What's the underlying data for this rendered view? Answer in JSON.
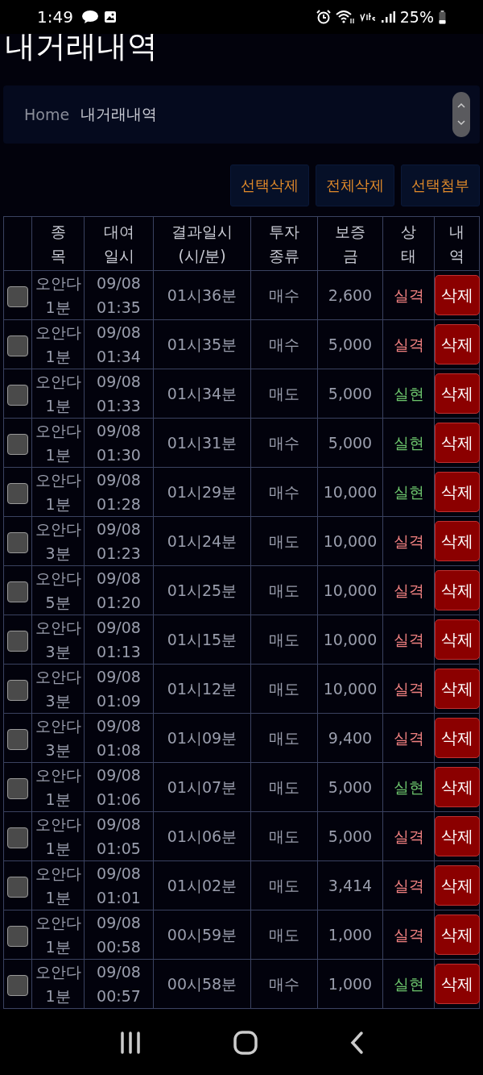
{
  "status_bar": {
    "time": "1:49",
    "battery": "25%"
  },
  "page_title": "내거래내역",
  "breadcrumb": {
    "home": "Home",
    "current": "내거래내역"
  },
  "actions": [
    "선택삭제",
    "전체삭제",
    "선택첨부"
  ],
  "table": {
    "columns": [
      [
        "종",
        "목"
      ],
      [
        "대여",
        "일시"
      ],
      [
        "결과일시",
        "(시/분)"
      ],
      [
        "투자",
        "종류"
      ],
      [
        "보증",
        "금"
      ],
      [
        "상",
        "태"
      ],
      [
        "내",
        "역"
      ]
    ],
    "rows": [
      {
        "checked": false,
        "item": [
          "오안다",
          "1분"
        ],
        "date": [
          "09/08",
          "01:35"
        ],
        "result_time": "01시36분",
        "type": "매수",
        "deposit": "2,600",
        "status": "실격",
        "kind": "fail",
        "action": "삭제"
      },
      {
        "checked": false,
        "item": [
          "오안다",
          "1분"
        ],
        "date": [
          "09/08",
          "01:34"
        ],
        "result_time": "01시35분",
        "type": "매수",
        "deposit": "5,000",
        "status": "실격",
        "kind": "fail",
        "action": "삭제"
      },
      {
        "checked": false,
        "item": [
          "오안다",
          "1분"
        ],
        "date": [
          "09/08",
          "01:33"
        ],
        "result_time": "01시34분",
        "type": "매도",
        "deposit": "5,000",
        "status": "실현",
        "kind": "win",
        "action": "삭제"
      },
      {
        "checked": false,
        "item": [
          "오안다",
          "1분"
        ],
        "date": [
          "09/08",
          "01:30"
        ],
        "result_time": "01시31분",
        "type": "매수",
        "deposit": "5,000",
        "status": "실현",
        "kind": "win",
        "action": "삭제"
      },
      {
        "checked": false,
        "item": [
          "오안다",
          "1분"
        ],
        "date": [
          "09/08",
          "01:28"
        ],
        "result_time": "01시29분",
        "type": "매수",
        "deposit": "10,000",
        "status": "실현",
        "kind": "win",
        "action": "삭제"
      },
      {
        "checked": false,
        "item": [
          "오안다",
          "3분"
        ],
        "date": [
          "09/08",
          "01:23"
        ],
        "result_time": "01시24분",
        "type": "매도",
        "deposit": "10,000",
        "status": "실격",
        "kind": "fail",
        "action": "삭제"
      },
      {
        "checked": false,
        "item": [
          "오안다",
          "5분"
        ],
        "date": [
          "09/08",
          "01:20"
        ],
        "result_time": "01시25분",
        "type": "매도",
        "deposit": "10,000",
        "status": "실격",
        "kind": "fail",
        "action": "삭제"
      },
      {
        "checked": false,
        "item": [
          "오안다",
          "3분"
        ],
        "date": [
          "09/08",
          "01:13"
        ],
        "result_time": "01시15분",
        "type": "매도",
        "deposit": "10,000",
        "status": "실격",
        "kind": "fail",
        "action": "삭제"
      },
      {
        "checked": false,
        "item": [
          "오안다",
          "3분"
        ],
        "date": [
          "09/08",
          "01:09"
        ],
        "result_time": "01시12분",
        "type": "매도",
        "deposit": "10,000",
        "status": "실격",
        "kind": "fail",
        "action": "삭제"
      },
      {
        "checked": false,
        "item": [
          "오안다",
          "3분"
        ],
        "date": [
          "09/08",
          "01:08"
        ],
        "result_time": "01시09분",
        "type": "매도",
        "deposit": "9,400",
        "status": "실격",
        "kind": "fail",
        "action": "삭제"
      },
      {
        "checked": false,
        "item": [
          "오안다",
          "1분"
        ],
        "date": [
          "09/08",
          "01:06"
        ],
        "result_time": "01시07분",
        "type": "매도",
        "deposit": "5,000",
        "status": "실현",
        "kind": "win",
        "action": "삭제"
      },
      {
        "checked": false,
        "item": [
          "오안다",
          "1분"
        ],
        "date": [
          "09/08",
          "01:05"
        ],
        "result_time": "01시06분",
        "type": "매도",
        "deposit": "5,000",
        "status": "실격",
        "kind": "fail",
        "action": "삭제"
      },
      {
        "checked": false,
        "item": [
          "오안다",
          "1분"
        ],
        "date": [
          "09/08",
          "01:01"
        ],
        "result_time": "01시02분",
        "type": "매도",
        "deposit": "3,414",
        "status": "실격",
        "kind": "fail",
        "action": "삭제"
      },
      {
        "checked": false,
        "item": [
          "오안다",
          "1분"
        ],
        "date": [
          "09/08",
          "00:58"
        ],
        "result_time": "00시59분",
        "type": "매도",
        "deposit": "1,000",
        "status": "실격",
        "kind": "fail",
        "action": "삭제"
      },
      {
        "checked": false,
        "item": [
          "오안다",
          "1분"
        ],
        "date": [
          "09/08",
          "00:57"
        ],
        "result_time": "00시58분",
        "type": "매수",
        "deposit": "1,000",
        "status": "실현",
        "kind": "win",
        "action": "삭제"
      }
    ]
  }
}
